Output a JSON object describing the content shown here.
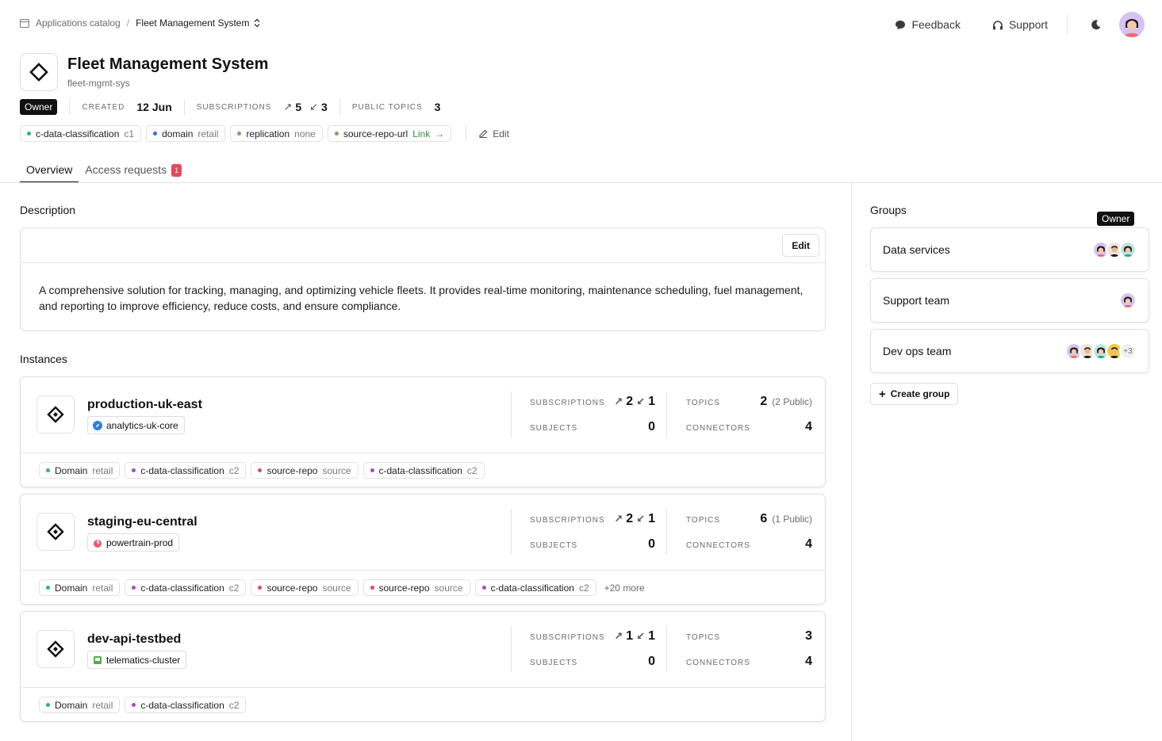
{
  "breadcrumb": {
    "root": "Applications catalog",
    "separator": "/",
    "current": "Fleet Management System"
  },
  "top_actions": {
    "feedback": "Feedback",
    "support": "Support"
  },
  "app": {
    "title": "Fleet Management System",
    "slug": "fleet-mgmt-sys"
  },
  "meta": {
    "owner": "Owner",
    "created_label": "CREATED",
    "created_value": "12 Jun",
    "subscriptions_label": "SUBSCRIPTIONS",
    "subs_out": "5",
    "subs_in": "3",
    "public_topics_label": "PUBLIC TOPICS",
    "public_topics_value": "3"
  },
  "tags": [
    {
      "key": "c-data-classification",
      "value": "c1",
      "color": "#2bb673"
    },
    {
      "key": "domain",
      "value": "retail",
      "color": "#3a6fd8"
    },
    {
      "key": "replication",
      "value": "none",
      "color": "#b08a6a"
    },
    {
      "key": "source-repo-url",
      "value": "Link",
      "color": "#b08a6a"
    }
  ],
  "edit_label": "Edit",
  "tabs": [
    {
      "label": "Overview"
    },
    {
      "label": "Access requests",
      "badge": "1"
    }
  ],
  "description": {
    "title": "Description",
    "edit": "Edit",
    "text": "A comprehensive solution for tracking, managing, and optimizing vehicle fleets. It provides real-time monitoring, maintenance scheduling, fuel management, and reporting to improve efficiency, reduce costs, and ensure compliance."
  },
  "instances_title": "Instances",
  "stat_labels": {
    "subscriptions": "SUBSCRIPTIONS",
    "subjects": "SUBJECTS",
    "topics": "TOPICS",
    "connectors": "CONNECTORS"
  },
  "instances": [
    {
      "name": "production-uk-east",
      "cluster": "analytics-uk-core",
      "subs_out": "2",
      "subs_in": "1",
      "subjects": "0",
      "topics": "2",
      "topics_public": "(2 Public)",
      "connectors": "4",
      "tags": [
        {
          "key": "Domain",
          "value": "retail",
          "color": "#2bb673"
        },
        {
          "key": "c-data-classification",
          "value": "c2",
          "color": "#a54dc9"
        },
        {
          "key": "source-repo",
          "value": "source",
          "color": "#e0457b"
        },
        {
          "key": "c-data-classification",
          "value": "c2",
          "color": "#a54dc9"
        }
      ],
      "more": ""
    },
    {
      "name": "staging-eu-central",
      "cluster": "powertrain-prod",
      "subs_out": "2",
      "subs_in": "1",
      "subjects": "0",
      "topics": "6",
      "topics_public": "(1 Public)",
      "connectors": "4",
      "tags": [
        {
          "key": "Domain",
          "value": "retail",
          "color": "#2bb673"
        },
        {
          "key": "c-data-classification",
          "value": "c2",
          "color": "#a54dc9"
        },
        {
          "key": "source-repo",
          "value": "source",
          "color": "#e0457b"
        },
        {
          "key": "source-repo",
          "value": "source",
          "color": "#e0457b"
        },
        {
          "key": "c-data-classification",
          "value": "c2",
          "color": "#a54dc9"
        }
      ],
      "more": "+20 more"
    },
    {
      "name": "dev-api-testbed",
      "cluster": "telematics-cluster",
      "subs_out": "1",
      "subs_in": "1",
      "subjects": "0",
      "topics": "3",
      "topics_public": "",
      "connectors": "4",
      "tags": [
        {
          "key": "Domain",
          "value": "retail",
          "color": "#2bb673"
        },
        {
          "key": "c-data-classification",
          "value": "c2",
          "color": "#a54dc9"
        }
      ],
      "more": ""
    }
  ],
  "groups": {
    "title": "Groups",
    "tooltip": "Owner",
    "items": [
      {
        "name": "Data services"
      },
      {
        "name": "Support team"
      },
      {
        "name": "Dev ops team",
        "extra": "+3"
      }
    ],
    "create": "Create group"
  }
}
